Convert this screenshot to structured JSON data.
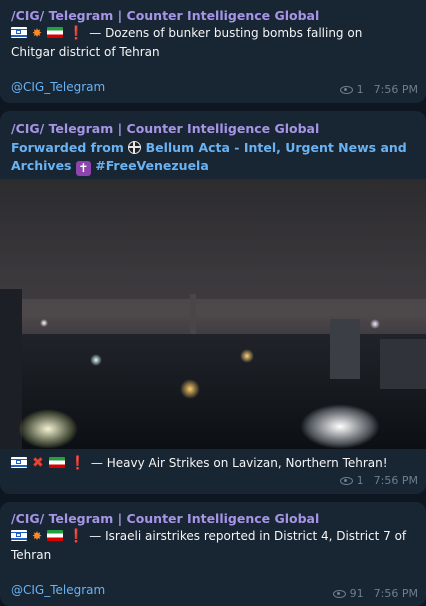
{
  "messages": [
    {
      "channel": "/CIG/ Telegram | Counter Intelligence Global",
      "text_line1": "— Dozens of bunker busting bombs falling on",
      "text_line2": "Chitgar district of Tehran",
      "handle": "@CIG_Telegram",
      "views": "1",
      "time": "7:56 PM"
    },
    {
      "channel": "/CIG/ Telegram | Counter Intelligence Global",
      "forwarded_prefix": "Forwarded from",
      "forwarded_source": "Bellum Acta - Intel, Urgent News and",
      "forwarded_source2": "Archives",
      "forwarded_tag": "#FreeVenezuela",
      "caption": "— Heavy Air Strikes on Lavizan, Northern Tehran!",
      "views": "1",
      "time": "7:56 PM"
    },
    {
      "channel": "/CIG/ Telegram | Counter Intelligence Global",
      "text_line1": "— Israeli airstrikes reported in District 4, District 7 of",
      "text_line2": "Tehran",
      "handle": "@CIG_Telegram",
      "views": "91",
      "time": "7:56 PM"
    }
  ],
  "icons": {
    "views": "eye-icon",
    "flag_israel": "israel-flag-icon",
    "flag_iran": "iran-flag-icon",
    "explosion": "collision-icon",
    "exclamation": "red-exclamation-icon",
    "cross": "cross-mark-icon",
    "latin_cross": "latin-cross-icon",
    "globe": "globe-icon"
  },
  "colors": {
    "background": "#0e1621",
    "bubble": "#182533",
    "channel_name": "#a695e7",
    "link": "#6ab3f3",
    "meta": "#6d7f8f"
  }
}
